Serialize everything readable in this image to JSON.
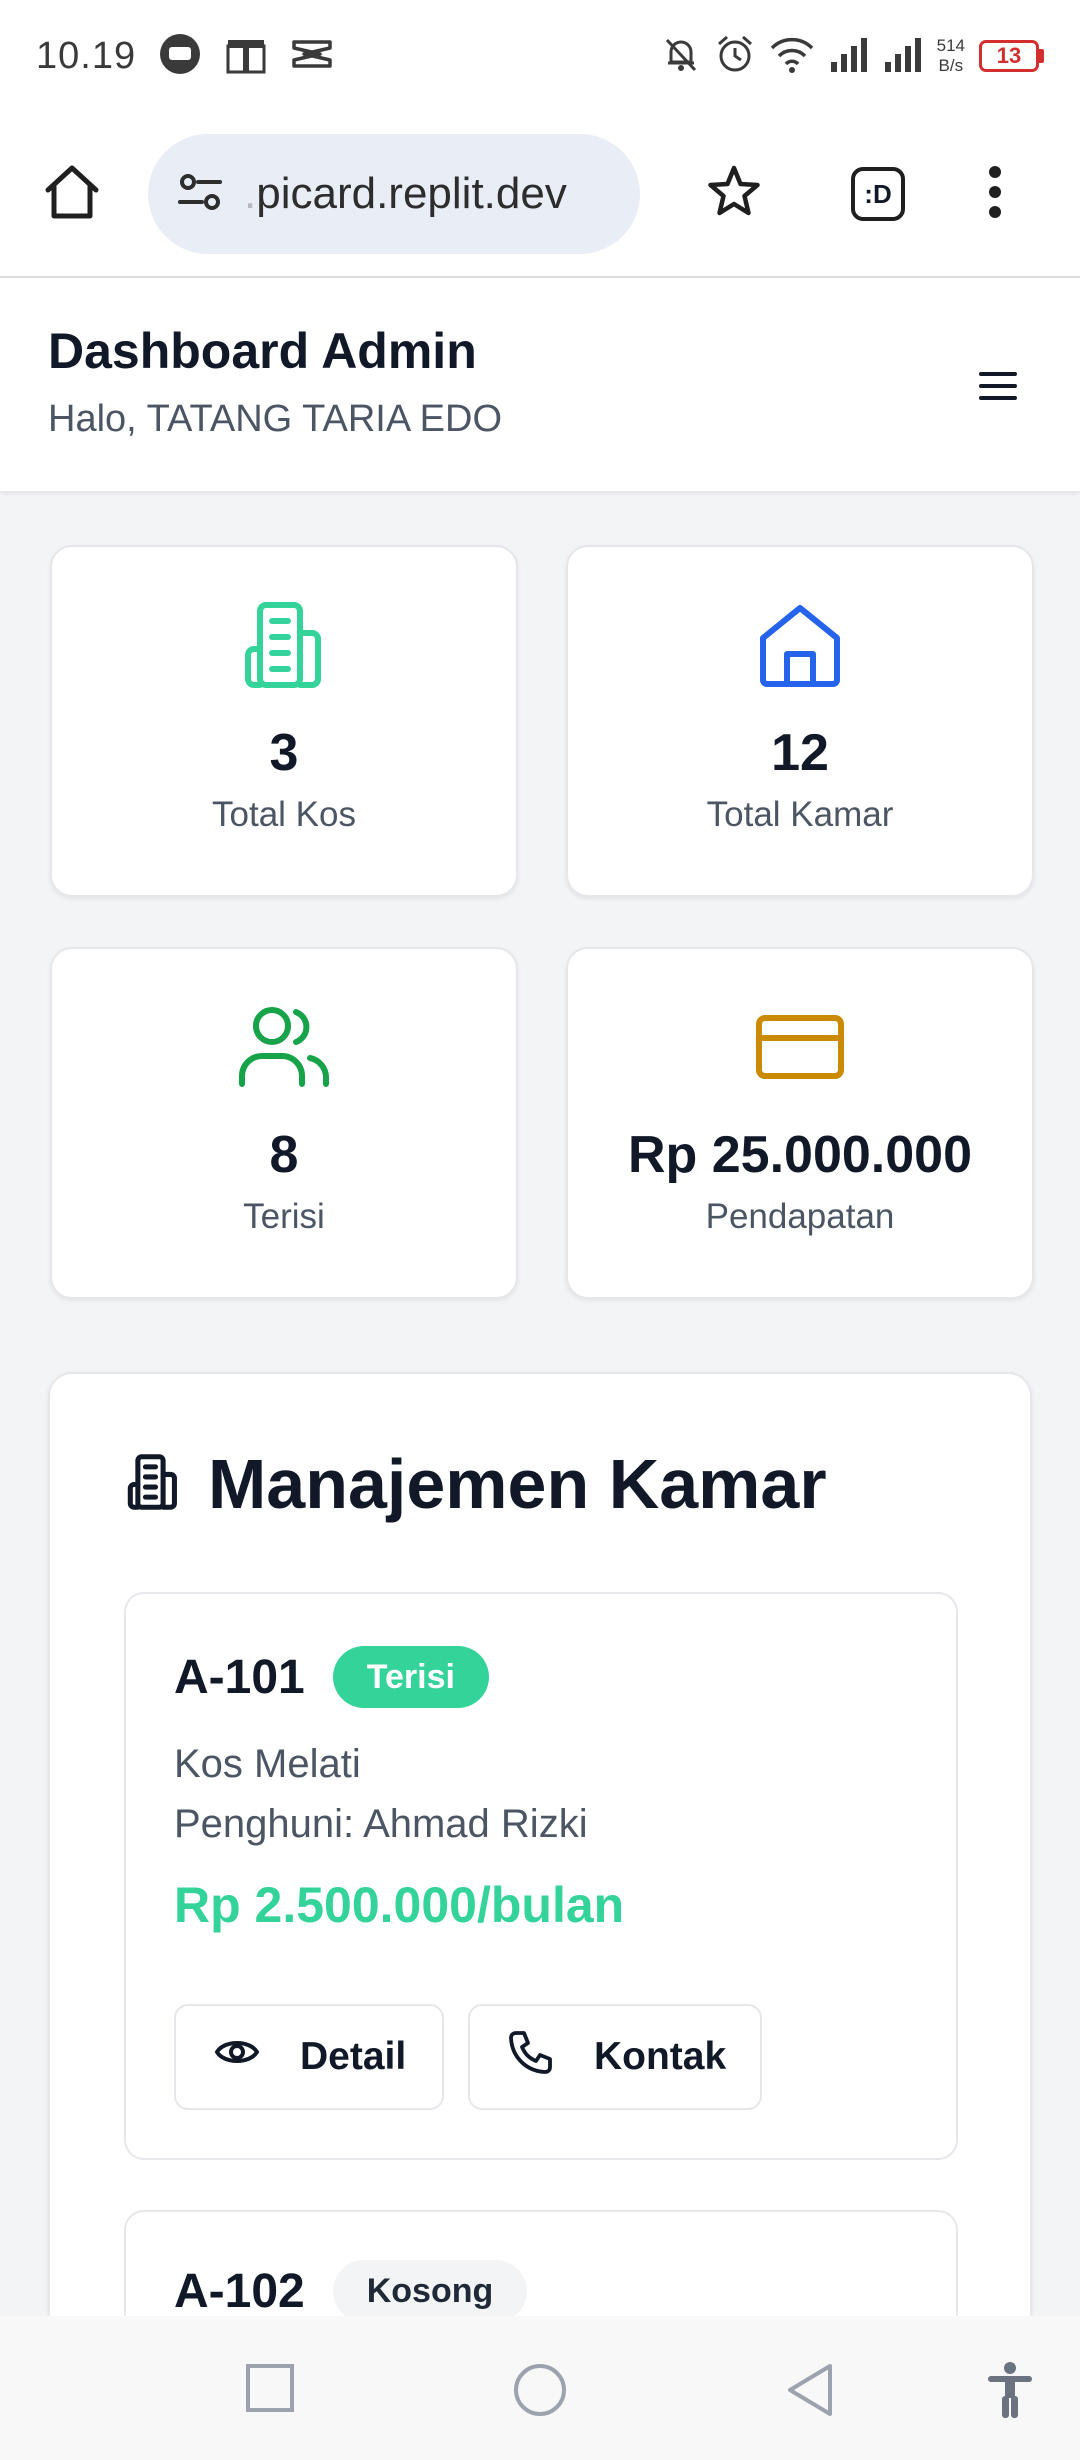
{
  "status_bar": {
    "time": "10.19",
    "net_speed_value": "514",
    "net_speed_unit": "B/s",
    "battery": "13"
  },
  "browser": {
    "url_faded": ".",
    "url": "picard.replit.dev",
    "tab_label": ":D",
    "icons": [
      "home-icon",
      "site-settings-icon",
      "bookmark-star-icon",
      "tab-switcher-icon",
      "more-menu-icon"
    ]
  },
  "header": {
    "title": "Dashboard Admin",
    "greeting": "Halo, TATANG TARIA EDO"
  },
  "stats": [
    {
      "value": "3",
      "label": "Total Kos",
      "icon": "building-icon",
      "color": "#34d399"
    },
    {
      "value": "12",
      "label": "Total Kamar",
      "icon": "house-icon",
      "color": "#2563eb"
    },
    {
      "value": "8",
      "label": "Terisi",
      "icon": "users-icon",
      "color": "#16a34a"
    },
    {
      "value": "Rp 25.000.000",
      "label": "Pendapatan",
      "icon": "credit-card-icon",
      "color": "#ca8a04"
    }
  ],
  "rooms_section": {
    "title": "Manajemen Kamar",
    "rooms": [
      {
        "code": "A-101",
        "status": "Terisi",
        "kos": "Kos Melati",
        "tenant": "Penghuni: Ahmad Rizki",
        "price": "Rp 2.500.000/bulan",
        "detail_label": "Detail",
        "contact_label": "Kontak"
      },
      {
        "code": "A-102",
        "status": "Kosong"
      }
    ]
  },
  "colors": {
    "accent_green": "#34d399",
    "blue": "#2563eb",
    "gold": "#ca8a04",
    "text_dark": "#111827",
    "text_muted": "#4b5563"
  }
}
